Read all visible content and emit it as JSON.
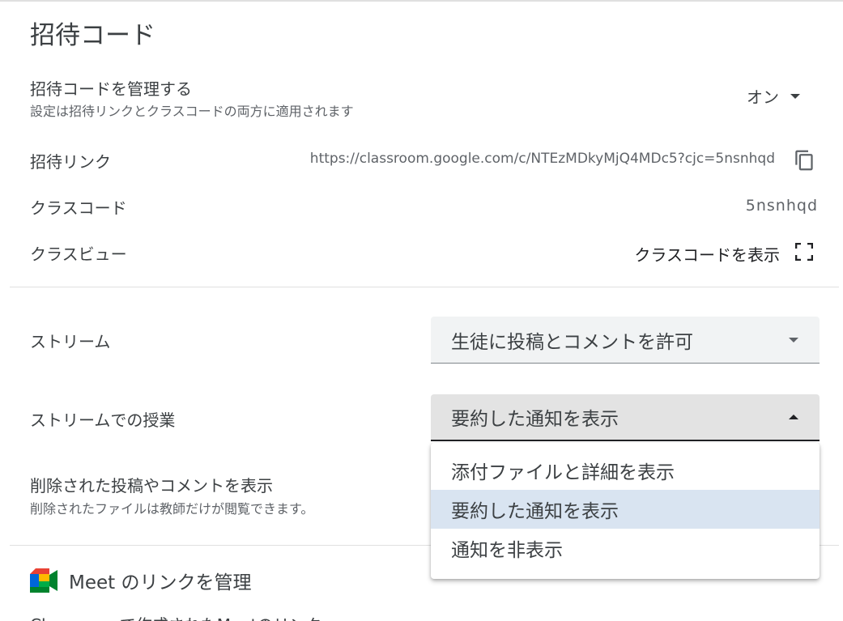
{
  "invite_codes": {
    "title": "招待コード",
    "manage": {
      "label": "招待コードを管理する",
      "description": "設定は招待リンクとクラスコードの両方に適用されます",
      "value": "オン"
    },
    "invite_link": {
      "label": "招待リンク",
      "url": "https://classroom.google.com/c/NTEzMDkyMjQ4MDc5?cjc=5nsnhqd",
      "copy_icon": "copy-icon"
    },
    "class_code": {
      "label": "クラスコード",
      "value": "5nsnhqd"
    },
    "class_view": {
      "label": "クラスビュー",
      "value": "クラスコードを表示",
      "icon": "expand-icon"
    }
  },
  "stream": {
    "label": "ストリーム",
    "value": "生徒に投稿とコメントを許可"
  },
  "classwork_on_stream": {
    "label": "ストリームでの授業",
    "value": "要約した通知を表示",
    "options": [
      "添付ファイルと詳細を表示",
      "要約した通知を表示",
      "通知を非表示"
    ],
    "selected_index": 1
  },
  "deleted_items": {
    "label": "削除された投稿やコメントを表示",
    "description": "削除されたファイルは教師だけが閲覧できます。"
  },
  "meet": {
    "title": "Meet のリンクを管理",
    "icon": "google-meet-icon",
    "cut_off_text": "Classroom で作成されたMeetのリンク"
  },
  "colors": {
    "meet_green": "#00832d",
    "meet_blue": "#0066da",
    "meet_red": "#e94235",
    "meet_yellow": "#ffba00",
    "selected_option_bg": "#d9e4f1"
  }
}
